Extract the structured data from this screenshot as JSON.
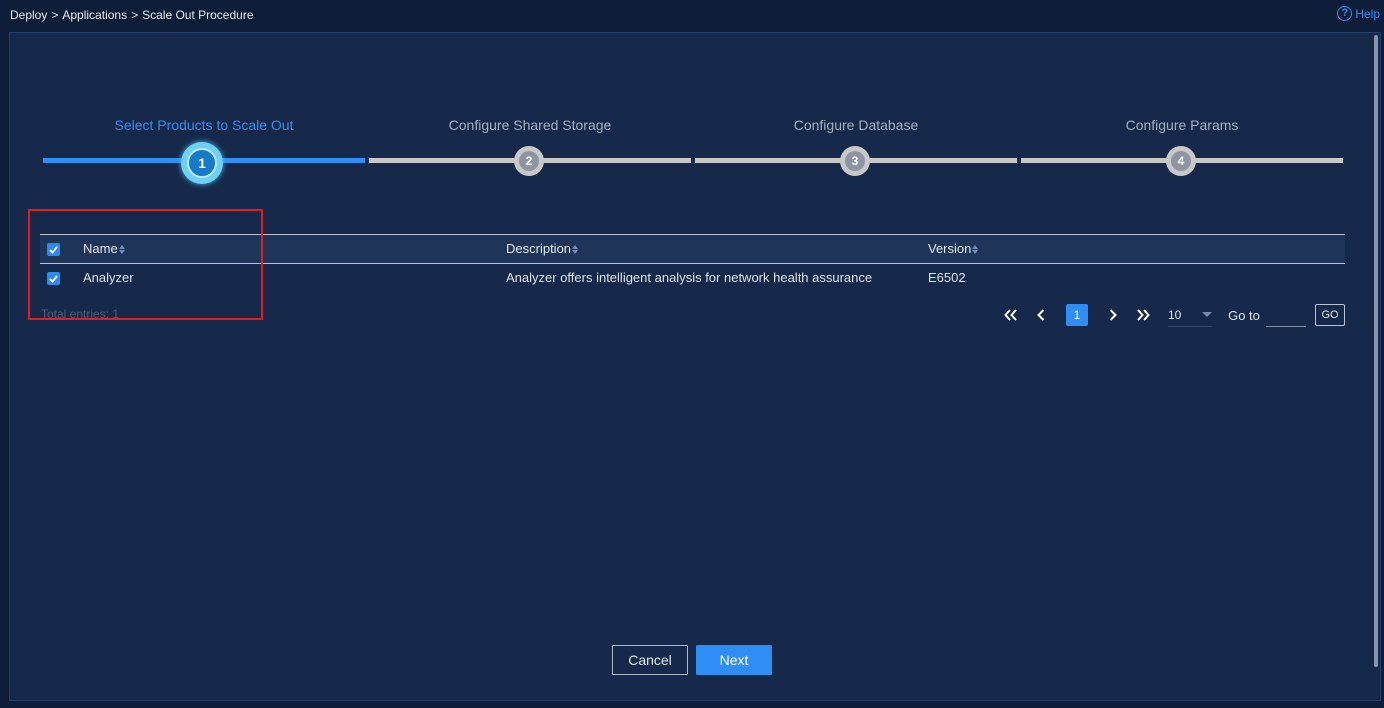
{
  "breadcrumb": {
    "items": [
      "Deploy",
      "Applications",
      "Scale Out Procedure"
    ],
    "separator": ">"
  },
  "help": {
    "label": "Help",
    "icon": "question-circle-icon"
  },
  "steps": [
    {
      "number": "1",
      "title": "Select Products to Scale Out",
      "state": "active"
    },
    {
      "number": "2",
      "title": "Configure Shared Storage",
      "state": "pending"
    },
    {
      "number": "3",
      "title": "Configure Database",
      "state": "pending"
    },
    {
      "number": "4",
      "title": "Configure Params",
      "state": "pending"
    }
  ],
  "table": {
    "select_all_checked": true,
    "columns": [
      "Name",
      "Description",
      "Version"
    ],
    "rows": [
      {
        "checked": true,
        "name": "Analyzer",
        "description": "Analyzer offers intelligent analysis for network health assurance",
        "version": "E6502"
      }
    ]
  },
  "total_entries": "Total entries: 1",
  "pagination": {
    "current_page": "1",
    "page_size": "10",
    "goto_label": "Go to",
    "goto_value": "",
    "go_label": "GO"
  },
  "buttons": {
    "cancel": "Cancel",
    "next": "Next"
  },
  "colors": {
    "accent": "#2e8ef5",
    "background": "#0f1e38",
    "panel": "#16294a",
    "highlight_box": "#e31d1d"
  }
}
